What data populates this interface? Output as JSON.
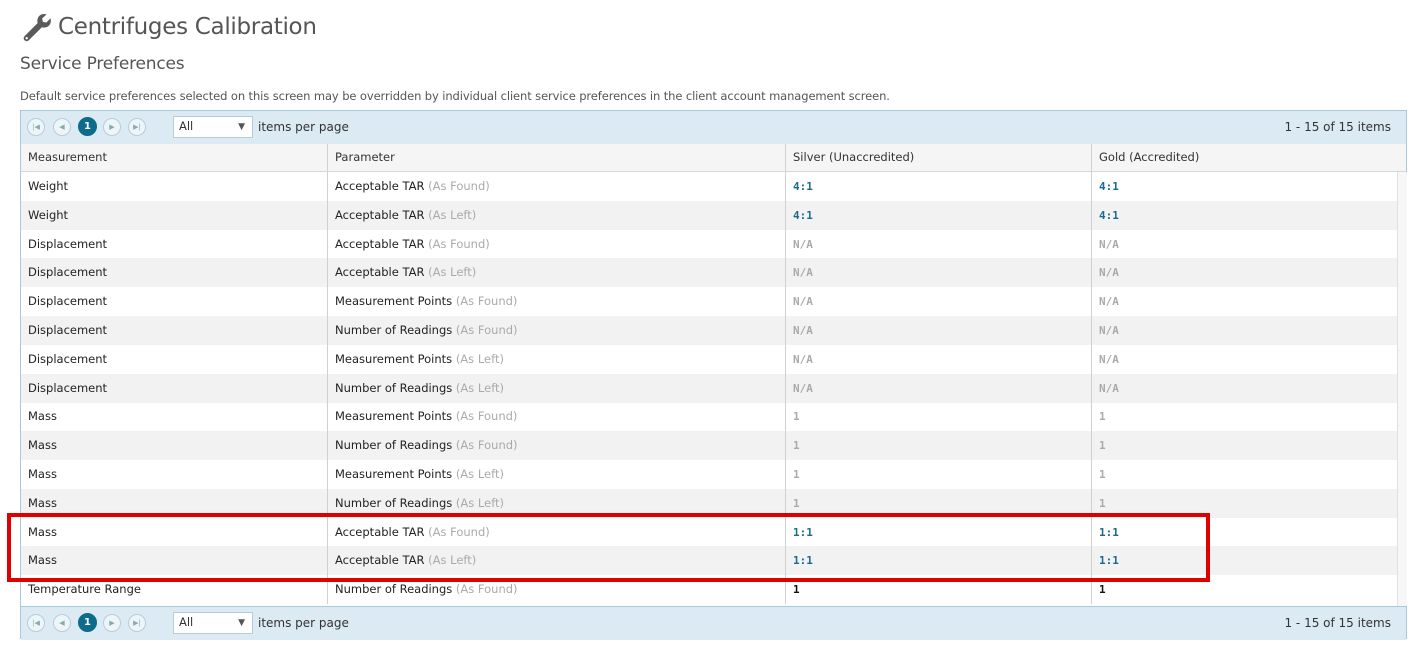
{
  "page": {
    "title": "Centrifuges Calibration",
    "title_icon": "wrench-icon"
  },
  "section_title": "Service Preferences",
  "description": "Default service preferences selected on this screen may be overridden by individual client service preferences in the client account management screen.",
  "pager": {
    "current_page": "1",
    "page_size": "All",
    "page_size_label": "items per page",
    "info": "1 - 15 of 15 items"
  },
  "columns": [
    "Measurement",
    "Parameter",
    "Silver (Unaccredited)",
    "Gold (Accredited)"
  ],
  "rows": [
    {
      "measurement": "Weight",
      "parameter": "Acceptable TAR",
      "suffix": "(As Found)",
      "silver": "4:1",
      "gold": "4:1",
      "style": "blue"
    },
    {
      "measurement": "Weight",
      "parameter": "Acceptable TAR",
      "suffix": "(As Left)",
      "silver": "4:1",
      "gold": "4:1",
      "style": "blue"
    },
    {
      "measurement": "Displacement",
      "parameter": "Acceptable TAR",
      "suffix": "(As Found)",
      "silver": "N/A",
      "gold": "N/A",
      "style": "gray"
    },
    {
      "measurement": "Displacement",
      "parameter": "Acceptable TAR",
      "suffix": "(As Left)",
      "silver": "N/A",
      "gold": "N/A",
      "style": "gray"
    },
    {
      "measurement": "Displacement",
      "parameter": "Measurement Points",
      "suffix": "(As Found)",
      "silver": "N/A",
      "gold": "N/A",
      "style": "gray"
    },
    {
      "measurement": "Displacement",
      "parameter": "Number of Readings",
      "suffix": "(As Found)",
      "silver": "N/A",
      "gold": "N/A",
      "style": "gray"
    },
    {
      "measurement": "Displacement",
      "parameter": "Measurement Points",
      "suffix": "(As Left)",
      "silver": "N/A",
      "gold": "N/A",
      "style": "gray"
    },
    {
      "measurement": "Displacement",
      "parameter": "Number of Readings",
      "suffix": "(As Left)",
      "silver": "N/A",
      "gold": "N/A",
      "style": "gray"
    },
    {
      "measurement": "Mass",
      "parameter": "Measurement Points",
      "suffix": "(As Found)",
      "silver": "1",
      "gold": "1",
      "style": "gray"
    },
    {
      "measurement": "Mass",
      "parameter": "Number of Readings",
      "suffix": "(As Found)",
      "silver": "1",
      "gold": "1",
      "style": "gray"
    },
    {
      "measurement": "Mass",
      "parameter": "Measurement Points",
      "suffix": "(As Left)",
      "silver": "1",
      "gold": "1",
      "style": "gray"
    },
    {
      "measurement": "Mass",
      "parameter": "Number of Readings",
      "suffix": "(As Left)",
      "silver": "1",
      "gold": "1",
      "style": "gray"
    },
    {
      "measurement": "Mass",
      "parameter": "Acceptable TAR",
      "suffix": "(As Found)",
      "silver": "1:1",
      "gold": "1:1",
      "style": "blue"
    },
    {
      "measurement": "Mass",
      "parameter": "Acceptable TAR",
      "suffix": "(As Left)",
      "silver": "1:1",
      "gold": "1:1",
      "style": "blue"
    },
    {
      "measurement": "Temperature Range",
      "parameter": "Number of Readings",
      "suffix": "(As Found)",
      "silver": "1",
      "gold": "1",
      "style": "black"
    }
  ],
  "colors": {
    "accent": "#0e6b8c",
    "value_blue": "#1a6a8c",
    "highlight": "#e00000",
    "pager_bg": "#dbeaf3"
  }
}
